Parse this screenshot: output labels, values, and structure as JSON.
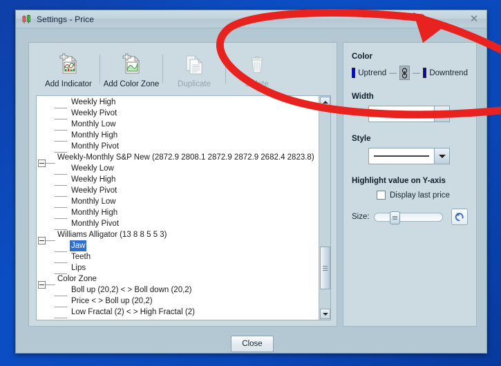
{
  "window": {
    "title": "Settings - Price",
    "icon": "candlestick-chart-icon",
    "close_label": "✕"
  },
  "toolbar": {
    "items": [
      {
        "label": "Add Indicator",
        "icon": "add-indicator-icon",
        "enabled": true
      },
      {
        "label": "Add Color Zone",
        "icon": "add-color-zone-icon",
        "enabled": true
      },
      {
        "label": "Duplicate",
        "icon": "duplicate-icon",
        "enabled": false
      },
      {
        "label": "Delete",
        "icon": "delete-trash-icon",
        "enabled": false
      }
    ]
  },
  "tree": {
    "rows": [
      {
        "label": "Weekly High",
        "level": 1,
        "kind": "leaf"
      },
      {
        "label": "Weekly Pivot",
        "level": 1,
        "kind": "leaf"
      },
      {
        "label": "Monthly Low",
        "level": 1,
        "kind": "leaf"
      },
      {
        "label": "Monthly High",
        "level": 1,
        "kind": "leaf"
      },
      {
        "label": "Monthly Pivot",
        "level": 1,
        "kind": "last"
      },
      {
        "label": "Weekly-Monthly S&P New (2872.9 2808.1 2872.9 2872.9 2682.4 2823.8)",
        "level": 0,
        "kind": "group"
      },
      {
        "label": "Weekly Low",
        "level": 1,
        "kind": "leaf"
      },
      {
        "label": "Weekly High",
        "level": 1,
        "kind": "leaf"
      },
      {
        "label": "Weekly Pivot",
        "level": 1,
        "kind": "leaf"
      },
      {
        "label": "Monthly Low",
        "level": 1,
        "kind": "leaf"
      },
      {
        "label": "Monthly High",
        "level": 1,
        "kind": "leaf"
      },
      {
        "label": "Monthly Pivot",
        "level": 1,
        "kind": "last"
      },
      {
        "label": "Williams Alligator (13 8 8 5 5 3)",
        "level": 0,
        "kind": "group"
      },
      {
        "label": "Jaw",
        "level": 1,
        "kind": "leaf",
        "selected": true
      },
      {
        "label": "Teeth",
        "level": 1,
        "kind": "leaf"
      },
      {
        "label": "Lips",
        "level": 1,
        "kind": "last"
      },
      {
        "label": "Color Zone",
        "level": 0,
        "kind": "group"
      },
      {
        "label": "Boll up (20,2) < > Boll down (20,2)",
        "level": 1,
        "kind": "leaf"
      },
      {
        "label": "Price < > Boll up (20,2)",
        "level": 1,
        "kind": "leaf"
      },
      {
        "label": "Low Fractal (2) < > High Fractal (2)",
        "level": 1,
        "kind": "last"
      }
    ],
    "scrollbar": {
      "up": "scroll-up-arrow",
      "down": "scroll-down-arrow"
    }
  },
  "properties": {
    "color": {
      "title": "Color",
      "uptrend_label": "Uptrend",
      "downtrend_label": "Downtrend",
      "uptrend_color": "#0000ee",
      "downtrend_color": "#0000ee",
      "link_icon": "chain-link-icon",
      "separator": "—"
    },
    "width": {
      "title": "Width",
      "selected": "1 px solid line"
    },
    "style": {
      "title": "Style",
      "selected": "solid line"
    },
    "highlight": {
      "title": "Highlight value on Y-axis",
      "checkbox_label": "Display last price",
      "checked": false,
      "size_label": "Size:",
      "size_value": 22,
      "reset_icon": "reset-arrow-icon"
    }
  },
  "footer": {
    "close_label": "Close"
  },
  "annotation": {
    "type": "red-ellipse-with-arrow",
    "color": "#e8231f"
  }
}
